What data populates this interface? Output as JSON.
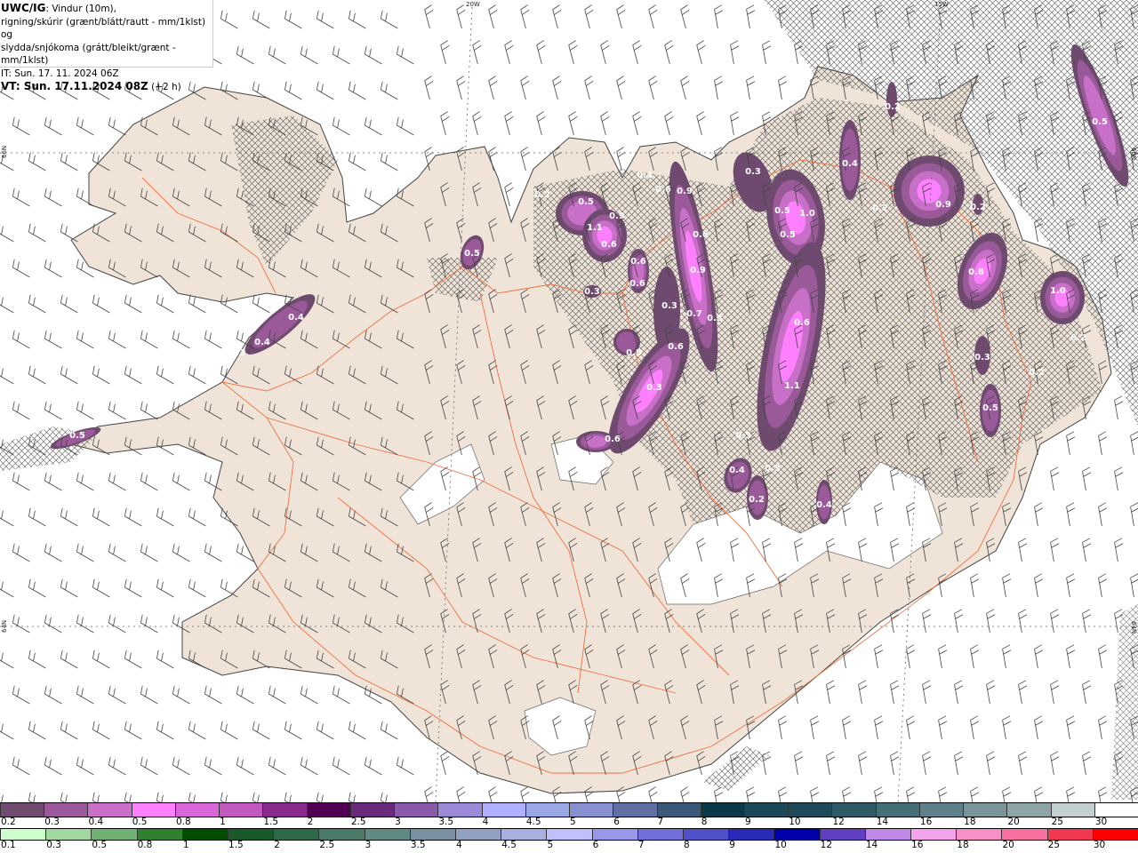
{
  "title": {
    "model": "UWC/IG",
    "line1_rest": ": Vindur (10m),",
    "line2": "rigning/skúrir (grænt/blátt/rautt - mm/1klst) og",
    "line3": "slydda/snjókoma (grátt/bleikt/grænt - mm/1klst)",
    "line4": "IT: Sun. 17. 11. 2024 06Z",
    "line5_bold": "VT: Sun. 17.11.2024 08Z",
    "line5_rest": " (+2 h)"
  },
  "geo_labels": {
    "lon_20w": "20W",
    "lon_15w": "15W",
    "lat_66n": "66N",
    "lat_64n": "64N"
  },
  "colors": {
    "land": "#f0e4d8",
    "sea": "#ffffff",
    "roads": "#f07040",
    "precip_outer": "#6e4a6e",
    "precip_mid": "#9a5a9a",
    "precip_inner": "#c870c8",
    "precip_core": "#ff80ff"
  },
  "precip_labels": [
    "0.5",
    "0.4",
    "0.4",
    "0.3",
    "0.5",
    "0.5",
    "0.2",
    "1.1",
    "0.9",
    "0.6",
    "0.6",
    "0.6",
    "0.3",
    "0.4",
    "0.6",
    "0.9",
    "0.6",
    "0.9",
    "0.3",
    "0.7",
    "0.3",
    "0.5",
    "0.6",
    "0.3",
    "0.6",
    "0.3",
    "0.5",
    "1.0",
    "0.5",
    "0.6",
    "1.1",
    "0.3",
    "0.4",
    "0.3",
    "0.2",
    "0.4",
    "0.4",
    "0.2",
    "0.9",
    "0.8",
    "1.0",
    "0.5",
    "0.3",
    "0.5",
    "0.2",
    "0.2",
    "0.2",
    "0.2"
  ],
  "legend_snow": {
    "labels": [
      "0.2",
      "0.3",
      "0.4",
      "0.5",
      "0.8",
      "1",
      "1.5",
      "2",
      "2.5",
      "3",
      "3.5",
      "4",
      "4.5",
      "5",
      "6",
      "7",
      "8",
      "9",
      "10",
      "12",
      "14",
      "16",
      "18",
      "20",
      "25",
      "30"
    ],
    "colors": [
      "#714a70",
      "#9a5a9a",
      "#c870c8",
      "#ff80ff",
      "#d868d8",
      "#c058c0",
      "#8a2a8a",
      "#500050",
      "#6a2a7a",
      "#8a5aaa",
      "#9a8ad8",
      "#b0b0ff",
      "#9aa8e8",
      "#8890d0",
      "#6070a0",
      "#3a5878",
      "#0a3a48",
      "#1a4a58",
      "#1e4a5a",
      "#2e5a68",
      "#466e76",
      "#5e8088",
      "#7a9498",
      "#8ea4a6",
      "#c4cfd0",
      "#ffffff"
    ]
  },
  "legend_rain": {
    "labels": [
      "0.1",
      "0.3",
      "0.5",
      "0.8",
      "1",
      "1.5",
      "2",
      "2.5",
      "3",
      "3.5",
      "4",
      "4.5",
      "5",
      "6",
      "7",
      "8",
      "9",
      "10",
      "12",
      "14",
      "16",
      "18",
      "20",
      "25",
      "30"
    ],
    "colors": [
      "#ccffcc",
      "#a0d8a0",
      "#70b070",
      "#308030",
      "#004c00",
      "#1a5a2a",
      "#2e6a48",
      "#4a7a68",
      "#608a84",
      "#7890a0",
      "#90a0c0",
      "#a8b0e0",
      "#c0c0ff",
      "#9898e8",
      "#7070d8",
      "#5050c8",
      "#2a2ab8",
      "#0000a8",
      "#6040c0",
      "#c088e8",
      "#f4a4ec",
      "#f890c8",
      "#f870a0",
      "#f03850",
      "#ff0000"
    ]
  }
}
